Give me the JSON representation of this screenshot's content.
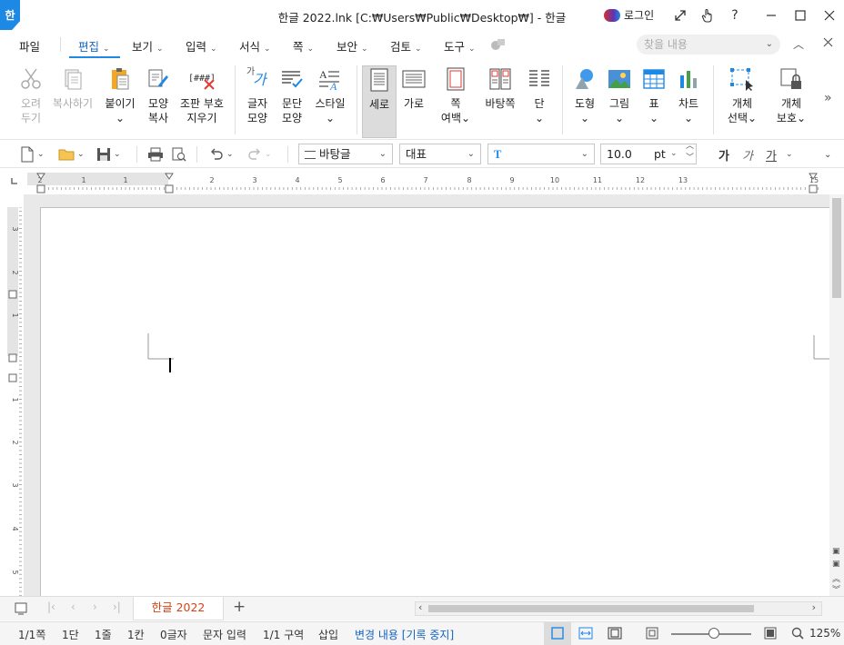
{
  "window": {
    "title": "한글 2022.lnk [C:₩Users₩Public₩Desktop₩] - 한글",
    "logo_char": "한",
    "login_label": "로그인"
  },
  "menu": {
    "file": "파일",
    "items": [
      "편집",
      "보기",
      "입력",
      "서식",
      "쪽",
      "보안",
      "검토",
      "도구"
    ],
    "search_placeholder": "찾을 내용"
  },
  "ribbon": {
    "buttons": [
      {
        "line1": "오려",
        "line2": "두기"
      },
      {
        "line1": "복사하기",
        "line2": ""
      },
      {
        "line1": "붙이기",
        "line2": "⌄"
      },
      {
        "line1": "모양",
        "line2": "복사"
      },
      {
        "line1": "조판 부호",
        "line2": "지우기"
      },
      {
        "line1": "글자",
        "line2": "모양"
      },
      {
        "line1": "문단",
        "line2": "모양"
      },
      {
        "line1": "스타일",
        "line2": "⌄"
      },
      {
        "line1": "세로",
        "line2": ""
      },
      {
        "line1": "가로",
        "line2": ""
      },
      {
        "line1": "쪽",
        "line2": "여백⌄"
      },
      {
        "line1": "바탕쪽",
        "line2": ""
      },
      {
        "line1": "단",
        "line2": "⌄"
      },
      {
        "line1": "도형",
        "line2": "⌄"
      },
      {
        "line1": "그림",
        "line2": "⌄"
      },
      {
        "line1": "표",
        "line2": "⌄"
      },
      {
        "line1": "차트",
        "line2": "⌄"
      },
      {
        "line1": "개체",
        "line2": "선택⌄"
      },
      {
        "line1": "개체",
        "line2": "보호⌄"
      }
    ],
    "format_symbol": "[###]",
    "char_sample_small": "가",
    "char_sample_big": "가"
  },
  "toolbar": {
    "style_combo": "바탕글",
    "font_kind_combo": "대표",
    "font_combo": "",
    "font_size": "10.0",
    "font_unit": "pt",
    "bold_label": "가",
    "italic_label": "가",
    "underline_label": "가"
  },
  "ruler": {
    "h_labels": [
      "2",
      "1",
      "1",
      "2",
      "3",
      "4",
      "5",
      "6",
      "7",
      "8",
      "9",
      "10",
      "11",
      "12",
      "13",
      "15"
    ],
    "v_labels": [
      "3",
      "2",
      "1",
      "1",
      "2",
      "3",
      "4",
      "5"
    ]
  },
  "tabs": {
    "doc_tab": "한글 2022",
    "add_tab": "+"
  },
  "status": {
    "page": "1/1쪽",
    "column": "1단",
    "line": "1줄",
    "char_pos": "1칸",
    "char_count": "0글자",
    "input_mode": "문자 입력",
    "section": "1/1 구역",
    "insert_mode": "삽입",
    "track_changes": "변경 내용 [기록 중지]",
    "zoom": "125%"
  }
}
